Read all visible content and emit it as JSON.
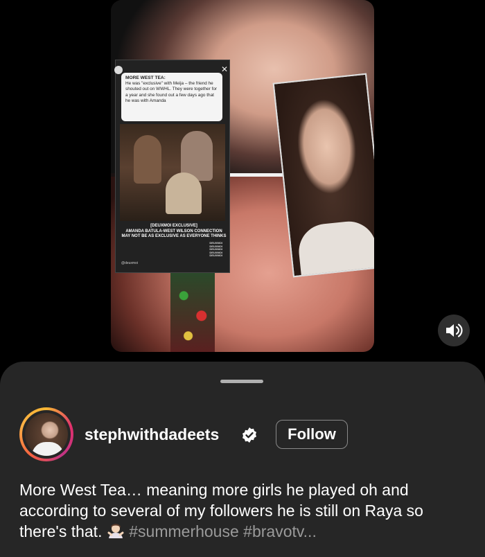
{
  "video": {
    "story_overlay": {
      "heading": "MORE WEST TEA:",
      "message": "He was \"exclusive\" with Meija – the friend he shouted out on WWHL. They were together for a year and she found out a few days ago that he was with Amanda",
      "caption_line1": "[DEUXMOI EXCLUSIVE]",
      "caption_line2": "AMANDA BATULA-WEST WILSON CONNECTION MAY NOT BE AS EXCLUSIVE AS EVERYONE THINKS",
      "watermark": "DEUXMOI DEUXMOI DEUXMOI DEUXMOI DEUXMOI",
      "handle": "@deuxmoi"
    },
    "volume_icon": "speaker-on-icon"
  },
  "post": {
    "username": "stephwithdadeets",
    "verified_icon": "verified-badge-icon",
    "follow_label": "Follow",
    "caption_text": "More West Tea… meaning more girls he played oh and according to several of my followers he is still on Raya so there's that. ",
    "caption_emoji": "woman-shrugging-emoji",
    "hashtags": "#summerhouse #bravotv..."
  },
  "colors": {
    "sheet_bg": "#262626",
    "hashtag": "#9a9a9a",
    "verified": "#ffffff"
  }
}
